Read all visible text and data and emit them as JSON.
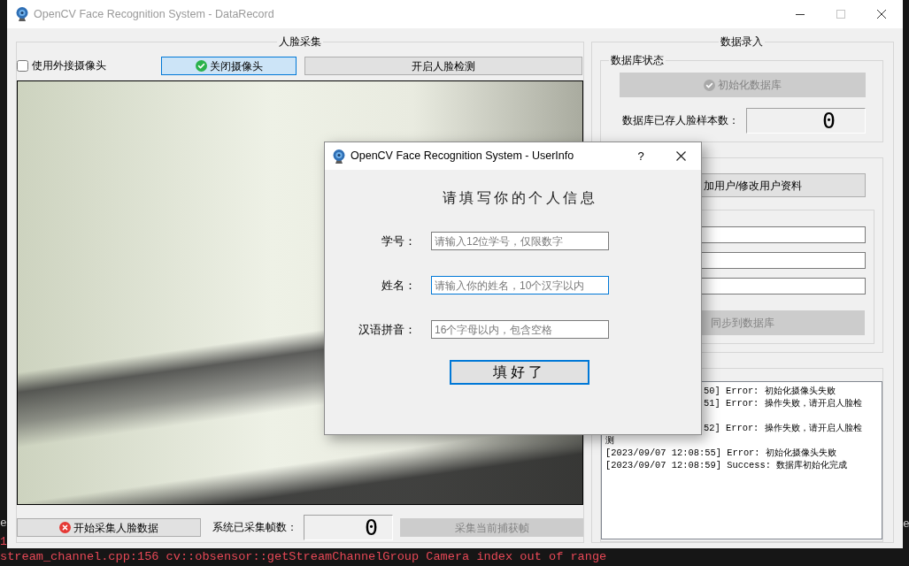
{
  "main_window": {
    "title": "OpenCV Face Recognition System - DataRecord",
    "active": false
  },
  "face_capture": {
    "title": "人脸采集",
    "external_camera_checkbox": {
      "label": "使用外接摄像头",
      "checked": false
    },
    "close_camera_button": {
      "label": "关闭摄像头",
      "highlighted": true,
      "disabled": false
    },
    "face_detection_button": {
      "label": "开启人脸检测",
      "highlighted": false,
      "disabled": false
    },
    "start_capture_button": {
      "label": "开始采集人脸数据",
      "disabled": false
    },
    "frame_count_label": "系统已采集帧数：",
    "frame_count": "0",
    "capture_frame_button": {
      "label": "采集当前捕获帧",
      "disabled": true
    }
  },
  "data_entry": {
    "title": "数据录入",
    "database_status": {
      "title": "数据库状态",
      "init_button": {
        "label": "初始化数据库",
        "disabled": true
      },
      "sample_count_label": "数据库已存人脸样本数：",
      "sample_count": "0"
    },
    "user_button": {
      "label": "加用户/修改用户资料",
      "disabled": false
    },
    "user_fields": [
      {
        "focused": false
      },
      {
        "focused": false
      },
      {
        "focused": false
      }
    ],
    "sync_button": {
      "label": "同步到数据库",
      "disabled": true
    },
    "log": [
      {
        "text": "50] Error: 初始化摄像头失败",
        "clipped": true
      },
      {
        "text": "51] Error: 操作失败，请开启人脸检",
        "clipped": true
      },
      {
        "text": "52] Error: 操作失败，请开启人脸检",
        "clipped": true
      },
      {
        "text": "测",
        "clipped": false
      },
      {
        "text": "[2023/09/07 12:08:55] Error: 初始化摄像头失败",
        "clipped": false
      },
      {
        "text": "[2023/09/07 12:08:59] Success: 数据库初始化完成",
        "clipped": false
      }
    ]
  },
  "user_info_dialog": {
    "title": "OpenCV Face Recognition System - UserInfo",
    "help": "?",
    "heading": "请填写你的个人信息",
    "fields": [
      {
        "label": "学号：",
        "placeholder": "请输入12位学号，仅限数字",
        "focused": false
      },
      {
        "label": "姓名：",
        "placeholder": "请输入你的姓名，10个汉字以内",
        "focused": true
      },
      {
        "label": "汉语拼音：",
        "placeholder": "16个字母以内，包含空格",
        "focused": false
      }
    ],
    "submit_button": {
      "label": "填好了",
      "default": true
    }
  },
  "terminal": {
    "left_edge": [
      {
        "text": "e",
        "color": "#c8c8c8"
      },
      {
        "text": "1",
        "color": "#e74856"
      }
    ],
    "right_edge": [
      {
        "text": "e",
        "color": "#c8c8c8"
      }
    ],
    "bottom_line": "stream_channel.cpp:156 cv::obsensor::getStreamChannelGroup Camera index out of range"
  }
}
